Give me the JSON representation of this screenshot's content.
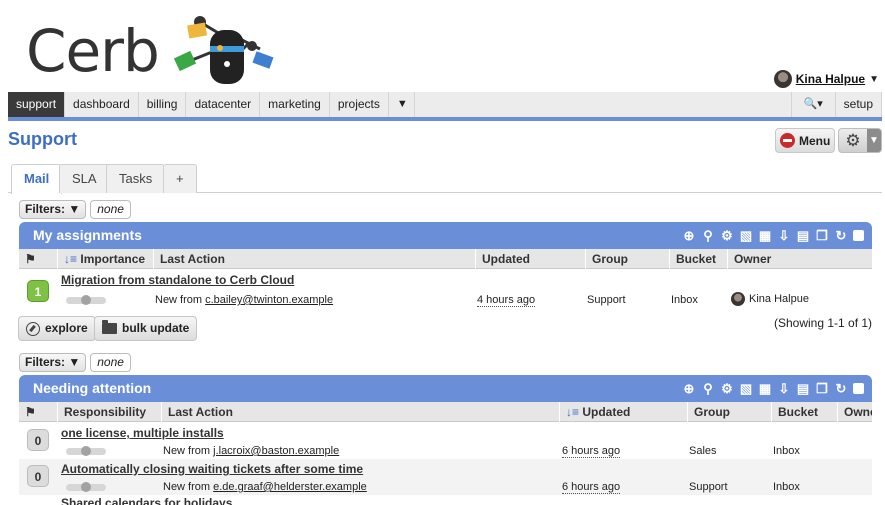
{
  "logo": {
    "text": "Cerb"
  },
  "user": {
    "name": "Kina Halpue"
  },
  "nav": {
    "tabs": [
      "support",
      "dashboard",
      "billing",
      "datacenter",
      "marketing",
      "projects"
    ],
    "active": "support",
    "setup_label": "setup"
  },
  "page": {
    "title": "Support",
    "menu_label": "Menu"
  },
  "subtabs": [
    "Mail",
    "SLA",
    "Tasks",
    "+"
  ],
  "filters": {
    "label": "Filters:",
    "value": "none"
  },
  "assignments": {
    "title": "My assignments",
    "columns": [
      "Importance",
      "Last Action",
      "Updated",
      "Group",
      "Bucket",
      "Owner"
    ],
    "rows": [
      {
        "importance": "1",
        "subject": "Migration from standalone to Cerb Cloud",
        "last_action_prefix": "New from",
        "last_action_email": "c.bailey@twinton.example",
        "updated": "4 hours ago",
        "group": "Support",
        "bucket": "Inbox",
        "owner": "Kina Halpue"
      }
    ],
    "explore_label": "explore",
    "bulk_label": "bulk update",
    "showing": "(Showing 1-1 of 1)"
  },
  "attention": {
    "title": "Needing attention",
    "columns": [
      "Responsibility",
      "Last Action",
      "Updated",
      "Group",
      "Bucket",
      "Owner"
    ],
    "rows": [
      {
        "importance": "0",
        "subject": "one license, multiple installs",
        "last_action_prefix": "New from",
        "last_action_email": "j.lacroix@baston.example",
        "updated": "6 hours ago",
        "group": "Sales",
        "bucket": "Inbox"
      },
      {
        "importance": "0",
        "subject": "Automatically closing waiting tickets after some time",
        "last_action_prefix": "New from",
        "last_action_email": "e.de.graaf@helderster.example",
        "updated": "6 hours ago",
        "group": "Support",
        "bucket": "Inbox"
      },
      {
        "subject": "Shared calendars for holidays"
      }
    ]
  },
  "colors": {
    "accent": "#6a8fd8",
    "title": "#3e6fc2",
    "importance_high": "#7dc243"
  }
}
